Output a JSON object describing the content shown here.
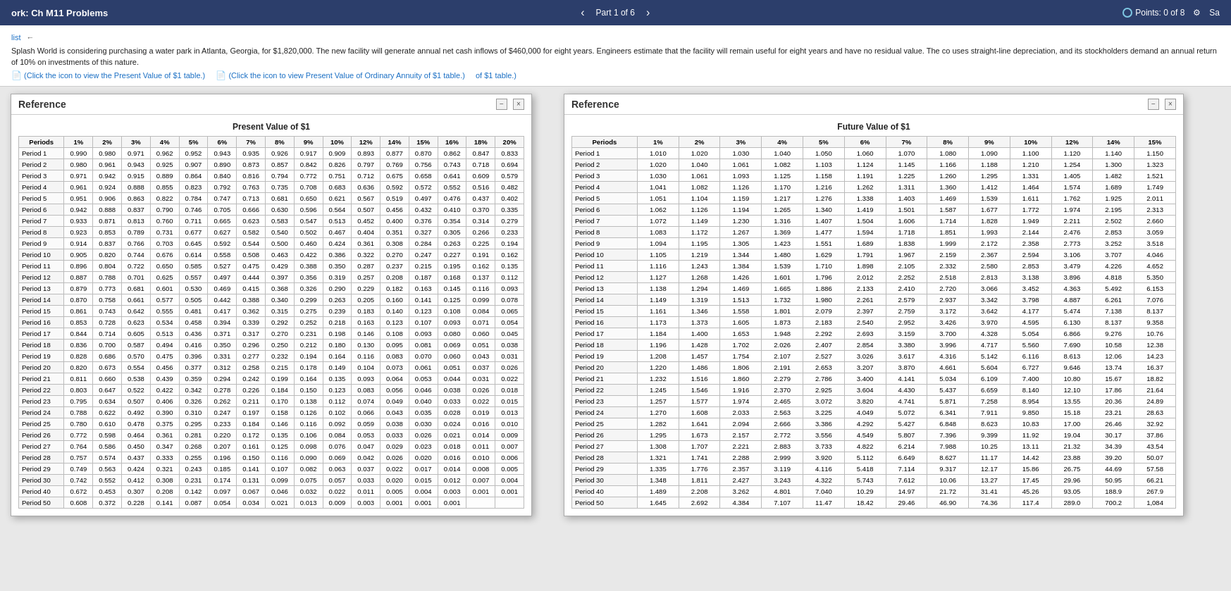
{
  "topbar": {
    "title": "ork: Ch M11 Problems",
    "nav_prev": "‹",
    "nav_next": "›",
    "part_label": "Part 1 of 6",
    "points_label": "Points: 0 of 8",
    "settings_icon": "⚙",
    "save_label": "Sa"
  },
  "problem": {
    "list_label": "list",
    "text": "Splash World is considering purchasing a water park in Atlanta, Georgia, for $1,820,000. The new facility will generate annual net cash inflows of $460,000 for eight years. Engineers estimate that the facility will remain useful for eight years and have no residual value. The co uses straight-line depreciation, and its stockholders demand an annual return of 10% on investments of this nature.",
    "link1": "(Click the icon to view the Present Value of $1 table.)",
    "link2": "(Click the icon to view Present Value of Ordinary Annuity of $1 table.)",
    "link3": "of $1 table.)"
  },
  "ref_window_1": {
    "title": "Reference",
    "table_title": "Present Value of $1",
    "controls": {
      "minimize": "−",
      "close": "×"
    },
    "headers": [
      "Periods",
      "1%",
      "2%",
      "3%",
      "4%",
      "5%",
      "6%",
      "7%",
      "8%",
      "9%",
      "10%",
      "12%",
      "14%",
      "15%",
      "16%",
      "18%",
      "20%"
    ],
    "rows": [
      [
        "Period 1",
        "0.990",
        "0.980",
        "0.971",
        "0.962",
        "0.952",
        "0.943",
        "0.935",
        "0.926",
        "0.917",
        "0.909",
        "0.893",
        "0.877",
        "0.870",
        "0.862",
        "0.847",
        "0.833"
      ],
      [
        "Period 2",
        "0.980",
        "0.961",
        "0.943",
        "0.925",
        "0.907",
        "0.890",
        "0.873",
        "0.857",
        "0.842",
        "0.826",
        "0.797",
        "0.769",
        "0.756",
        "0.743",
        "0.718",
        "0.694"
      ],
      [
        "Period 3",
        "0.971",
        "0.942",
        "0.915",
        "0.889",
        "0.864",
        "0.840",
        "0.816",
        "0.794",
        "0.772",
        "0.751",
        "0.712",
        "0.675",
        "0.658",
        "0.641",
        "0.609",
        "0.579"
      ],
      [
        "Period 4",
        "0.961",
        "0.924",
        "0.888",
        "0.855",
        "0.823",
        "0.792",
        "0.763",
        "0.735",
        "0.708",
        "0.683",
        "0.636",
        "0.592",
        "0.572",
        "0.552",
        "0.516",
        "0.482"
      ],
      [
        "Period 5",
        "0.951",
        "0.906",
        "0.863",
        "0.822",
        "0.784",
        "0.747",
        "0.713",
        "0.681",
        "0.650",
        "0.621",
        "0.567",
        "0.519",
        "0.497",
        "0.476",
        "0.437",
        "0.402"
      ],
      [
        "Period 6",
        "0.942",
        "0.888",
        "0.837",
        "0.790",
        "0.746",
        "0.705",
        "0.666",
        "0.630",
        "0.596",
        "0.564",
        "0.507",
        "0.456",
        "0.432",
        "0.410",
        "0.370",
        "0.335"
      ],
      [
        "Period 7",
        "0.933",
        "0.871",
        "0.813",
        "0.760",
        "0.711",
        "0.665",
        "0.623",
        "0.583",
        "0.547",
        "0.513",
        "0.452",
        "0.400",
        "0.376",
        "0.354",
        "0.314",
        "0.279"
      ],
      [
        "Period 8",
        "0.923",
        "0.853",
        "0.789",
        "0.731",
        "0.677",
        "0.627",
        "0.582",
        "0.540",
        "0.502",
        "0.467",
        "0.404",
        "0.351",
        "0.327",
        "0.305",
        "0.266",
        "0.233"
      ],
      [
        "Period 9",
        "0.914",
        "0.837",
        "0.766",
        "0.703",
        "0.645",
        "0.592",
        "0.544",
        "0.500",
        "0.460",
        "0.424",
        "0.361",
        "0.308",
        "0.284",
        "0.263",
        "0.225",
        "0.194"
      ],
      [
        "Period 10",
        "0.905",
        "0.820",
        "0.744",
        "0.676",
        "0.614",
        "0.558",
        "0.508",
        "0.463",
        "0.422",
        "0.386",
        "0.322",
        "0.270",
        "0.247",
        "0.227",
        "0.191",
        "0.162"
      ],
      [
        "Period 11",
        "0.896",
        "0.804",
        "0.722",
        "0.650",
        "0.585",
        "0.527",
        "0.475",
        "0.429",
        "0.388",
        "0.350",
        "0.287",
        "0.237",
        "0.215",
        "0.195",
        "0.162",
        "0.135"
      ],
      [
        "Period 12",
        "0.887",
        "0.788",
        "0.701",
        "0.625",
        "0.557",
        "0.497",
        "0.444",
        "0.397",
        "0.356",
        "0.319",
        "0.257",
        "0.208",
        "0.187",
        "0.168",
        "0.137",
        "0.112"
      ],
      [
        "Period 13",
        "0.879",
        "0.773",
        "0.681",
        "0.601",
        "0.530",
        "0.469",
        "0.415",
        "0.368",
        "0.326",
        "0.290",
        "0.229",
        "0.182",
        "0.163",
        "0.145",
        "0.116",
        "0.093"
      ],
      [
        "Period 14",
        "0.870",
        "0.758",
        "0.661",
        "0.577",
        "0.505",
        "0.442",
        "0.388",
        "0.340",
        "0.299",
        "0.263",
        "0.205",
        "0.160",
        "0.141",
        "0.125",
        "0.099",
        "0.078"
      ],
      [
        "Period 15",
        "0.861",
        "0.743",
        "0.642",
        "0.555",
        "0.481",
        "0.417",
        "0.362",
        "0.315",
        "0.275",
        "0.239",
        "0.183",
        "0.140",
        "0.123",
        "0.108",
        "0.084",
        "0.065"
      ],
      [
        "Period 16",
        "0.853",
        "0.728",
        "0.623",
        "0.534",
        "0.458",
        "0.394",
        "0.339",
        "0.292",
        "0.252",
        "0.218",
        "0.163",
        "0.123",
        "0.107",
        "0.093",
        "0.071",
        "0.054"
      ],
      [
        "Period 17",
        "0.844",
        "0.714",
        "0.605",
        "0.513",
        "0.436",
        "0.371",
        "0.317",
        "0.270",
        "0.231",
        "0.198",
        "0.146",
        "0.108",
        "0.093",
        "0.080",
        "0.060",
        "0.045"
      ],
      [
        "Period 18",
        "0.836",
        "0.700",
        "0.587",
        "0.494",
        "0.416",
        "0.350",
        "0.296",
        "0.250",
        "0.212",
        "0.180",
        "0.130",
        "0.095",
        "0.081",
        "0.069",
        "0.051",
        "0.038"
      ],
      [
        "Period 19",
        "0.828",
        "0.686",
        "0.570",
        "0.475",
        "0.396",
        "0.331",
        "0.277",
        "0.232",
        "0.194",
        "0.164",
        "0.116",
        "0.083",
        "0.070",
        "0.060",
        "0.043",
        "0.031"
      ],
      [
        "Period 20",
        "0.820",
        "0.673",
        "0.554",
        "0.456",
        "0.377",
        "0.312",
        "0.258",
        "0.215",
        "0.178",
        "0.149",
        "0.104",
        "0.073",
        "0.061",
        "0.051",
        "0.037",
        "0.026"
      ],
      [
        "Period 21",
        "0.811",
        "0.660",
        "0.538",
        "0.439",
        "0.359",
        "0.294",
        "0.242",
        "0.199",
        "0.164",
        "0.135",
        "0.093",
        "0.064",
        "0.053",
        "0.044",
        "0.031",
        "0.022"
      ],
      [
        "Period 22",
        "0.803",
        "0.647",
        "0.522",
        "0.422",
        "0.342",
        "0.278",
        "0.226",
        "0.184",
        "0.150",
        "0.123",
        "0.083",
        "0.056",
        "0.046",
        "0.038",
        "0.026",
        "0.018"
      ],
      [
        "Period 23",
        "0.795",
        "0.634",
        "0.507",
        "0.406",
        "0.326",
        "0.262",
        "0.211",
        "0.170",
        "0.138",
        "0.112",
        "0.074",
        "0.049",
        "0.040",
        "0.033",
        "0.022",
        "0.015"
      ],
      [
        "Period 24",
        "0.788",
        "0.622",
        "0.492",
        "0.390",
        "0.310",
        "0.247",
        "0.197",
        "0.158",
        "0.126",
        "0.102",
        "0.066",
        "0.043",
        "0.035",
        "0.028",
        "0.019",
        "0.013"
      ],
      [
        "Period 25",
        "0.780",
        "0.610",
        "0.478",
        "0.375",
        "0.295",
        "0.233",
        "0.184",
        "0.146",
        "0.116",
        "0.092",
        "0.059",
        "0.038",
        "0.030",
        "0.024",
        "0.016",
        "0.010"
      ],
      [
        "Period 26",
        "0.772",
        "0.598",
        "0.464",
        "0.361",
        "0.281",
        "0.220",
        "0.172",
        "0.135",
        "0.106",
        "0.084",
        "0.053",
        "0.033",
        "0.026",
        "0.021",
        "0.014",
        "0.009"
      ],
      [
        "Period 27",
        "0.764",
        "0.586",
        "0.450",
        "0.347",
        "0.268",
        "0.207",
        "0.161",
        "0.125",
        "0.098",
        "0.076",
        "0.047",
        "0.029",
        "0.023",
        "0.018",
        "0.011",
        "0.007"
      ],
      [
        "Period 28",
        "0.757",
        "0.574",
        "0.437",
        "0.333",
        "0.255",
        "0.196",
        "0.150",
        "0.116",
        "0.090",
        "0.069",
        "0.042",
        "0.026",
        "0.020",
        "0.016",
        "0.010",
        "0.006"
      ],
      [
        "Period 29",
        "0.749",
        "0.563",
        "0.424",
        "0.321",
        "0.243",
        "0.185",
        "0.141",
        "0.107",
        "0.082",
        "0.063",
        "0.037",
        "0.022",
        "0.017",
        "0.014",
        "0.008",
        "0.005"
      ],
      [
        "Period 30",
        "0.742",
        "0.552",
        "0.412",
        "0.308",
        "0.231",
        "0.174",
        "0.131",
        "0.099",
        "0.075",
        "0.057",
        "0.033",
        "0.020",
        "0.015",
        "0.012",
        "0.007",
        "0.004"
      ],
      [
        "Period 40",
        "0.672",
        "0.453",
        "0.307",
        "0.208",
        "0.142",
        "0.097",
        "0.067",
        "0.046",
        "0.032",
        "0.022",
        "0.011",
        "0.005",
        "0.004",
        "0.003",
        "0.001",
        "0.001"
      ],
      [
        "Period 50",
        "0.608",
        "0.372",
        "0.228",
        "0.141",
        "0.087",
        "0.054",
        "0.034",
        "0.021",
        "0.013",
        "0.009",
        "0.003",
        "0.001",
        "0.001",
        "0.001",
        "",
        ""
      ]
    ]
  },
  "ref_window_2": {
    "title": "Reference",
    "table_title": "Future Value of $1",
    "controls": {
      "minimize": "−",
      "close": "×"
    },
    "headers": [
      "Periods",
      "1%",
      "2%",
      "3%",
      "4%",
      "5%",
      "6%",
      "7%",
      "8%",
      "9%",
      "10%",
      "12%",
      "14%",
      "15%"
    ],
    "rows": [
      [
        "Period 1",
        "1.010",
        "1.020",
        "1.030",
        "1.040",
        "1.050",
        "1.060",
        "1.070",
        "1.080",
        "1.090",
        "1.100",
        "1.120",
        "1.140",
        "1.150"
      ],
      [
        "Period 2",
        "1.020",
        "1.040",
        "1.061",
        "1.082",
        "1.103",
        "1.124",
        "1.145",
        "1.166",
        "1.188",
        "1.210",
        "1.254",
        "1.300",
        "1.323"
      ],
      [
        "Period 3",
        "1.030",
        "1.061",
        "1.093",
        "1.125",
        "1.158",
        "1.191",
        "1.225",
        "1.260",
        "1.295",
        "1.331",
        "1.405",
        "1.482",
        "1.521"
      ],
      [
        "Period 4",
        "1.041",
        "1.082",
        "1.126",
        "1.170",
        "1.216",
        "1.262",
        "1.311",
        "1.360",
        "1.412",
        "1.464",
        "1.574",
        "1.689",
        "1.749"
      ],
      [
        "Period 5",
        "1.051",
        "1.104",
        "1.159",
        "1.217",
        "1.276",
        "1.338",
        "1.403",
        "1.469",
        "1.539",
        "1.611",
        "1.762",
        "1.925",
        "2.011"
      ],
      [
        "Period 6",
        "1.062",
        "1.126",
        "1.194",
        "1.265",
        "1.340",
        "1.419",
        "1.501",
        "1.587",
        "1.677",
        "1.772",
        "1.974",
        "2.195",
        "2.313"
      ],
      [
        "Period 7",
        "1.072",
        "1.149",
        "1.230",
        "1.316",
        "1.407",
        "1.504",
        "1.606",
        "1.714",
        "1.828",
        "1.949",
        "2.211",
        "2.502",
        "2.660"
      ],
      [
        "Period 8",
        "1.083",
        "1.172",
        "1.267",
        "1.369",
        "1.477",
        "1.594",
        "1.718",
        "1.851",
        "1.993",
        "2.144",
        "2.476",
        "2.853",
        "3.059"
      ],
      [
        "Period 9",
        "1.094",
        "1.195",
        "1.305",
        "1.423",
        "1.551",
        "1.689",
        "1.838",
        "1.999",
        "2.172",
        "2.358",
        "2.773",
        "3.252",
        "3.518"
      ],
      [
        "Period 10",
        "1.105",
        "1.219",
        "1.344",
        "1.480",
        "1.629",
        "1.791",
        "1.967",
        "2.159",
        "2.367",
        "2.594",
        "3.106",
        "3.707",
        "4.046"
      ],
      [
        "Period 11",
        "1.116",
        "1.243",
        "1.384",
        "1.539",
        "1.710",
        "1.898",
        "2.105",
        "2.332",
        "2.580",
        "2.853",
        "3.479",
        "4.226",
        "4.652"
      ],
      [
        "Period 12",
        "1.127",
        "1.268",
        "1.426",
        "1.601",
        "1.796",
        "2.012",
        "2.252",
        "2.518",
        "2.813",
        "3.138",
        "3.896",
        "4.818",
        "5.350"
      ],
      [
        "Period 13",
        "1.138",
        "1.294",
        "1.469",
        "1.665",
        "1.886",
        "2.133",
        "2.410",
        "2.720",
        "3.066",
        "3.452",
        "4.363",
        "5.492",
        "6.153"
      ],
      [
        "Period 14",
        "1.149",
        "1.319",
        "1.513",
        "1.732",
        "1.980",
        "2.261",
        "2.579",
        "2.937",
        "3.342",
        "3.798",
        "4.887",
        "6.261",
        "7.076"
      ],
      [
        "Period 15",
        "1.161",
        "1.346",
        "1.558",
        "1.801",
        "2.079",
        "2.397",
        "2.759",
        "3.172",
        "3.642",
        "4.177",
        "5.474",
        "7.138",
        "8.137"
      ],
      [
        "Period 16",
        "1.173",
        "1.373",
        "1.605",
        "1.873",
        "2.183",
        "2.540",
        "2.952",
        "3.426",
        "3.970",
        "4.595",
        "6.130",
        "8.137",
        "9.358"
      ],
      [
        "Period 17",
        "1.184",
        "1.400",
        "1.653",
        "1.948",
        "2.292",
        "2.693",
        "3.159",
        "3.700",
        "4.328",
        "5.054",
        "6.866",
        "9.276",
        "10.76"
      ],
      [
        "Period 18",
        "1.196",
        "1.428",
        "1.702",
        "2.026",
        "2.407",
        "2.854",
        "3.380",
        "3.996",
        "4.717",
        "5.560",
        "7.690",
        "10.58",
        "12.38"
      ],
      [
        "Period 19",
        "1.208",
        "1.457",
        "1.754",
        "2.107",
        "2.527",
        "3.026",
        "3.617",
        "4.316",
        "5.142",
        "6.116",
        "8.613",
        "12.06",
        "14.23"
      ],
      [
        "Period 20",
        "1.220",
        "1.486",
        "1.806",
        "2.191",
        "2.653",
        "3.207",
        "3.870",
        "4.661",
        "5.604",
        "6.727",
        "9.646",
        "13.74",
        "16.37"
      ],
      [
        "Period 21",
        "1.232",
        "1.516",
        "1.860",
        "2.279",
        "2.786",
        "3.400",
        "4.141",
        "5.034",
        "6.109",
        "7.400",
        "10.80",
        "15.67",
        "18.82"
      ],
      [
        "Period 22",
        "1.245",
        "1.546",
        "1.916",
        "2.370",
        "2.925",
        "3.604",
        "4.430",
        "5.437",
        "6.659",
        "8.140",
        "12.10",
        "17.86",
        "21.64"
      ],
      [
        "Period 23",
        "1.257",
        "1.577",
        "1.974",
        "2.465",
        "3.072",
        "3.820",
        "4.741",
        "5.871",
        "7.258",
        "8.954",
        "13.55",
        "20.36",
        "24.89"
      ],
      [
        "Period 24",
        "1.270",
        "1.608",
        "2.033",
        "2.563",
        "3.225",
        "4.049",
        "5.072",
        "6.341",
        "7.911",
        "9.850",
        "15.18",
        "23.21",
        "28.63"
      ],
      [
        "Period 25",
        "1.282",
        "1.641",
        "2.094",
        "2.666",
        "3.386",
        "4.292",
        "5.427",
        "6.848",
        "8.623",
        "10.83",
        "17.00",
        "26.46",
        "32.92"
      ],
      [
        "Period 26",
        "1.295",
        "1.673",
        "2.157",
        "2.772",
        "3.556",
        "4.549",
        "5.807",
        "7.396",
        "9.399",
        "11.92",
        "19.04",
        "30.17",
        "37.86"
      ],
      [
        "Period 27",
        "1.308",
        "1.707",
        "2.221",
        "2.883",
        "3.733",
        "4.822",
        "6.214",
        "7.988",
        "10.25",
        "13.11",
        "21.32",
        "34.39",
        "43.54"
      ],
      [
        "Period 28",
        "1.321",
        "1.741",
        "2.288",
        "2.999",
        "3.920",
        "5.112",
        "6.649",
        "8.627",
        "11.17",
        "14.42",
        "23.88",
        "39.20",
        "50.07"
      ],
      [
        "Period 29",
        "1.335",
        "1.776",
        "2.357",
        "3.119",
        "4.116",
        "5.418",
        "7.114",
        "9.317",
        "12.17",
        "15.86",
        "26.75",
        "44.69",
        "57.58"
      ],
      [
        "Period 30",
        "1.348",
        "1.811",
        "2.427",
        "3.243",
        "4.322",
        "5.743",
        "7.612",
        "10.06",
        "13.27",
        "17.45",
        "29.96",
        "50.95",
        "66.21"
      ],
      [
        "Period 40",
        "1.489",
        "2.208",
        "3.262",
        "4.801",
        "7.040",
        "10.29",
        "14.97",
        "21.72",
        "31.41",
        "45.26",
        "93.05",
        "188.9",
        "267.9"
      ],
      [
        "Period 50",
        "1.645",
        "2.692",
        "4.384",
        "7.107",
        "11.47",
        "18.42",
        "29.46",
        "46.90",
        "74.36",
        "117.4",
        "289.0",
        "700.2",
        "1,084"
      ]
    ]
  }
}
